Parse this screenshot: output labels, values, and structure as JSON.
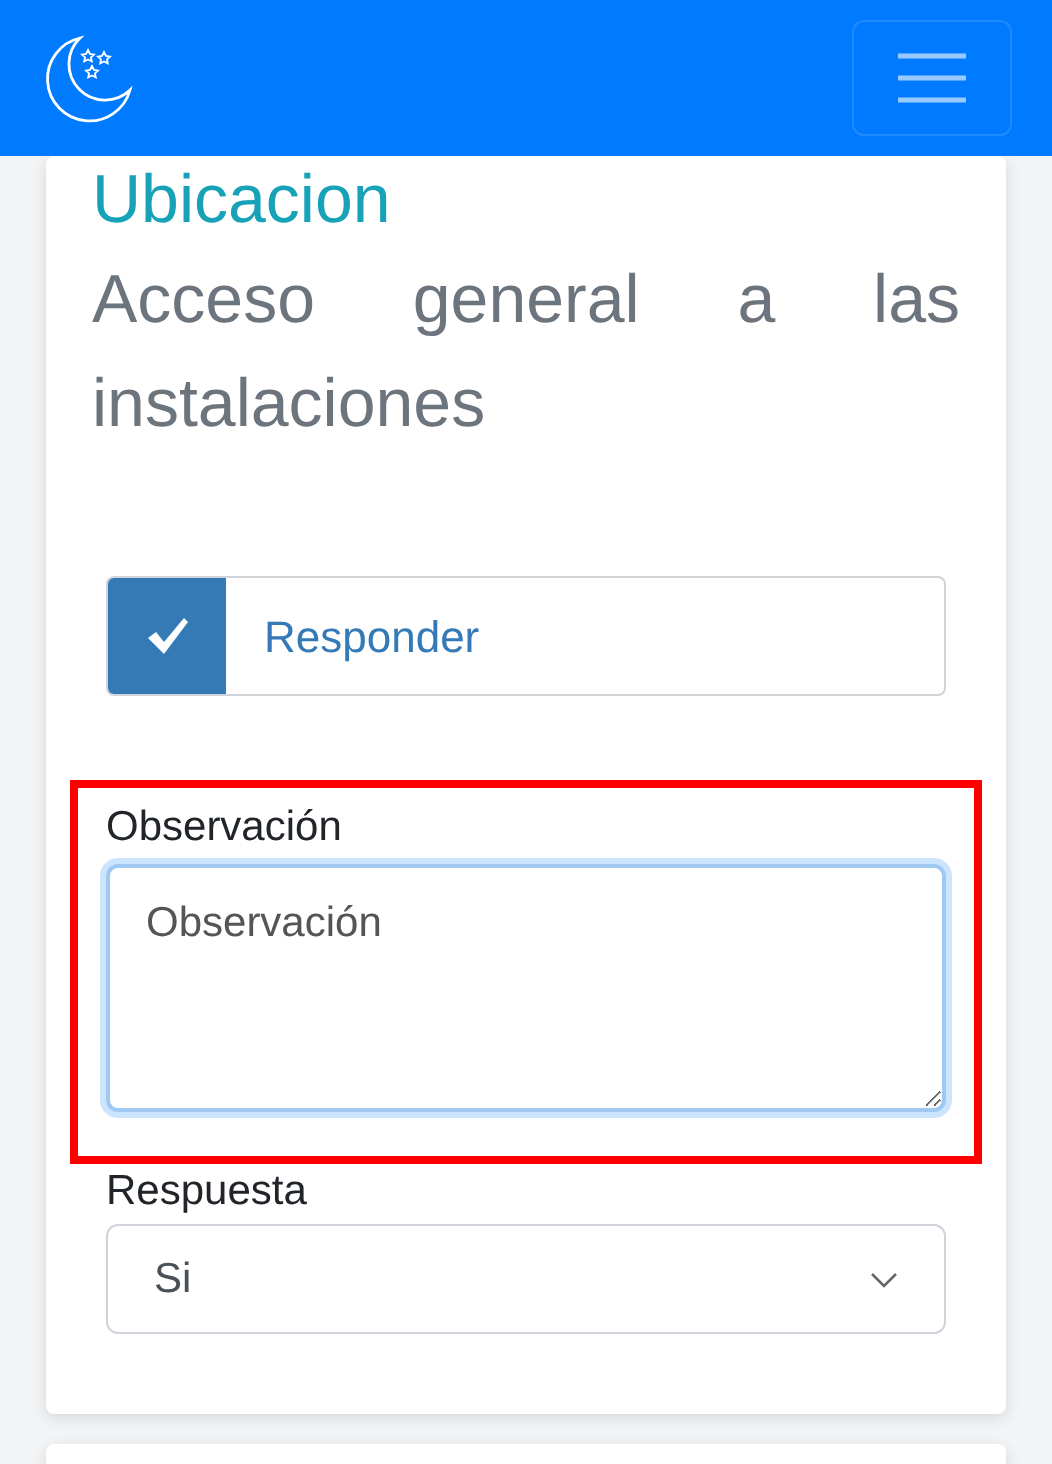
{
  "card": {
    "title": "Ubicacion",
    "description": "Acceso general a las instalaciones",
    "checkbox": {
      "label": "Responder",
      "checked": true
    },
    "observation": {
      "label": "Observación",
      "placeholder": "Observación",
      "highlighted": true
    },
    "answer": {
      "label": "Respuesta",
      "value": "Si"
    }
  }
}
